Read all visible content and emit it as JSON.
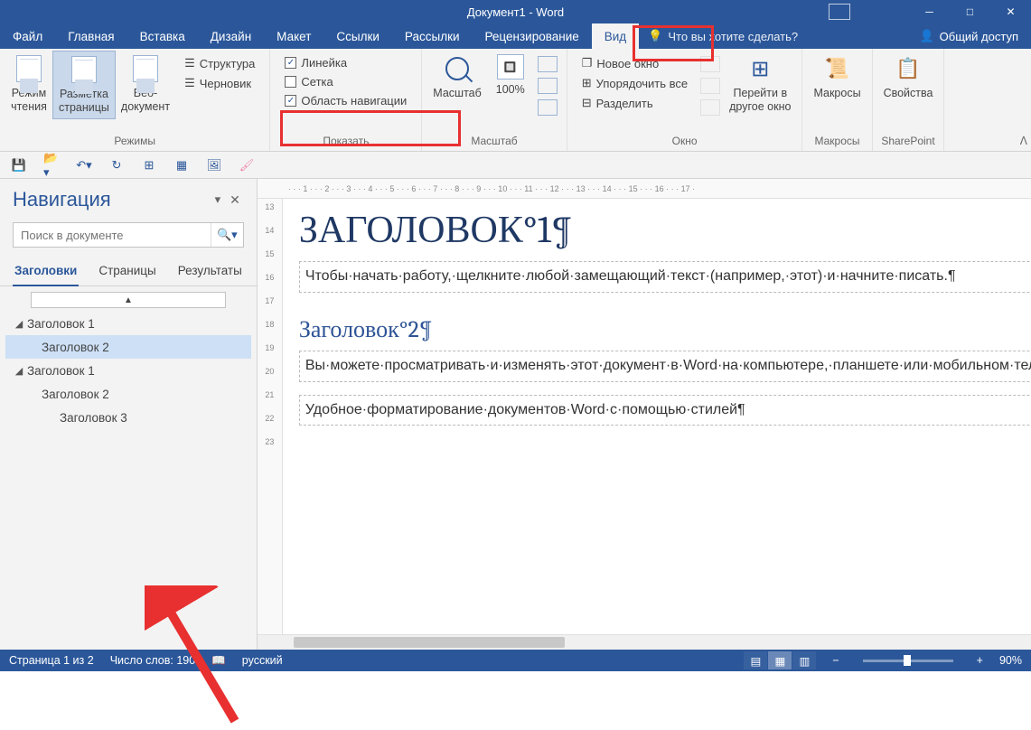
{
  "title": "Документ1 - Word",
  "menu": {
    "file": "Файл",
    "home": "Главная",
    "insert": "Вставка",
    "design": "Дизайн",
    "layout": "Макет",
    "refs": "Ссылки",
    "mail": "Рассылки",
    "review": "Рецензирование",
    "view": "Вид",
    "tell": "Что вы хотите сделать?",
    "share": "Общий доступ"
  },
  "ribbon": {
    "modes": {
      "label": "Режимы",
      "read": "Режим\nчтения",
      "page": "Разметка\nстраницы",
      "web": "Веб-\nдокумент"
    },
    "show": {
      "label": "Показать",
      "struct": "Структура",
      "draft": "Черновик",
      "ruler": "Линейка",
      "grid": "Сетка",
      "nav": "Область навигации"
    },
    "zoom": {
      "label": "Масштаб",
      "zoom": "Масштаб",
      "p100": "100%"
    },
    "window": {
      "label": "Окно",
      "neww": "Новое окно",
      "arrange": "Упорядочить все",
      "split": "Разделить",
      "goto": "Перейти в\nдругое окно"
    },
    "macros": {
      "label": "Макросы",
      "macros": "Макросы"
    },
    "sp": {
      "label": "SharePoint",
      "props": "Свойства"
    }
  },
  "nav": {
    "title": "Навигация",
    "search_ph": "Поиск в документе",
    "tabs": {
      "headings": "Заголовки",
      "pages": "Страницы",
      "results": "Результаты"
    },
    "tree": [
      {
        "level": 1,
        "text": "Заголовок 1",
        "expanded": true,
        "children": [
          {
            "level": 2,
            "text": "Заголовок 2",
            "selected": true
          }
        ]
      },
      {
        "level": 1,
        "text": "Заголовок 1",
        "expanded": true,
        "children": [
          {
            "level": 2,
            "text": "Заголовок 2"
          },
          {
            "level": 3,
            "text": "Заголовок 3"
          }
        ]
      }
    ]
  },
  "doc": {
    "h1": "ЗАГОЛОВОК°1¶",
    "p1": "Чтобы·начать·работу,·щелкните·любой·замещающий·текст·(например,·этот)·и·начните·писать.¶",
    "h2": "Заголовок°2¶",
    "p2": "Вы·можете·просматривать·и·изменять·этот·документ·в·Word·на·компьютере,·планшете·или·мобильном·телефоне.·Редактируйте·текст,·вставляйте·содержимое,·например·рисунки,·фигуры·и·таблицы,·и·сохраняйте·документ·в·облаке·с·помощью·приложения·Word·на·компьютерах·Mac,·устройствах·с·Windows,·Android·или·iOS.¶",
    "p3": "Удобное·форматирование·документов·Word·с·помощью·стилей¶"
  },
  "status": {
    "page": "Страница 1 из 2",
    "words": "Число слов: 190",
    "lang": "русский",
    "zoom": "90%"
  },
  "ruler_h": "· · · 1 · · · 2 · · · 3 · · · 4 · · · 5 · · · 6 · · · 7 · · · 8 · · · 9 · · · 10 · · · 11 · · · 12 · · · 13 · · · 14 · · · 15 · · · 16 · · · 17 ·",
  "ruler_v": [
    "13",
    "",
    "14",
    "",
    "15",
    "",
    "16",
    "",
    "17",
    "",
    "18",
    "",
    "19",
    "",
    "20",
    "",
    "21",
    "",
    "22",
    "",
    "23"
  ]
}
